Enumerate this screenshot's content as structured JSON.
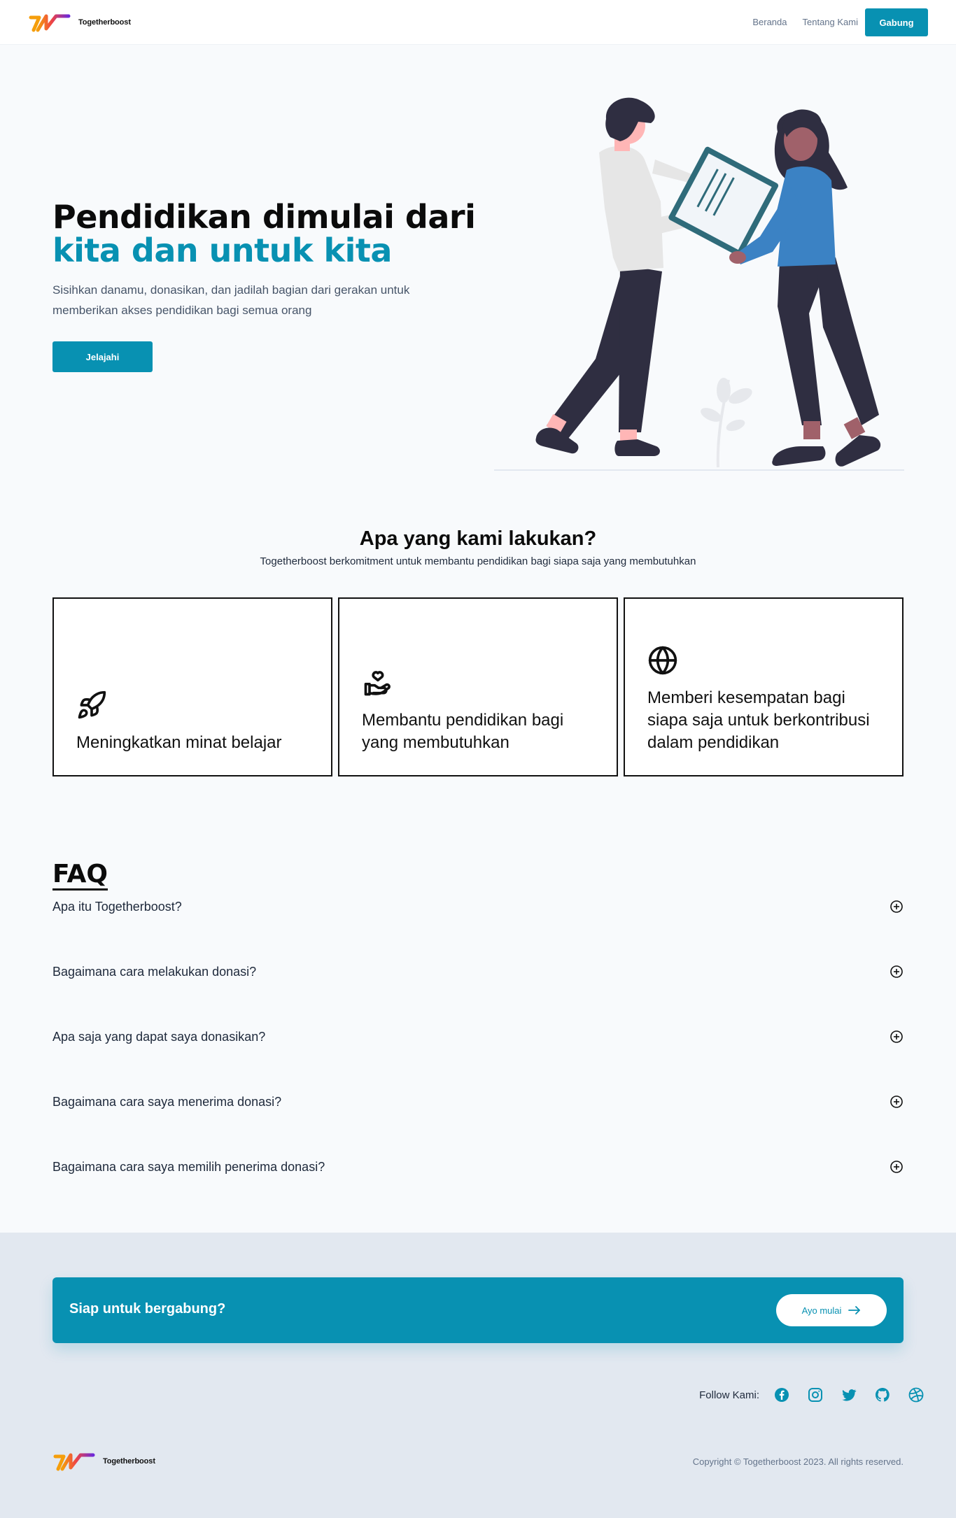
{
  "brand": {
    "name": "Togetherboost"
  },
  "nav": {
    "links": [
      "Beranda",
      "Tentang Kami"
    ],
    "cta": "Gabung"
  },
  "hero": {
    "title_line1": "Pendidikan dimulai dari",
    "title_line2": "kita dan untuk kita",
    "subtitle": "Sisihkan danamu, donasikan, dan jadilah bagian dari gerakan untuk memberikan akses pendidikan bagi semua orang",
    "button": "Jelajahi"
  },
  "what_we_do": {
    "title": "Apa yang kami lakukan?",
    "subtitle": "Togetherboost berkomitment untuk membantu pendidikan bagi siapa saja yang membutuhkan",
    "cards": [
      {
        "icon": "rocket-icon",
        "text": "Meningkatkan minat belajar"
      },
      {
        "icon": "hand-heart-icon",
        "text": "Membantu pendidikan bagi yang membutuhkan"
      },
      {
        "icon": "globe-icon",
        "text": "Memberi kesempatan bagi siapa saja untuk berkontribusi dalam pendidikan"
      }
    ]
  },
  "faq": {
    "title": "FAQ",
    "items": [
      "Apa itu Togetherboost?",
      "Bagaimana cara melakukan donasi?",
      "Apa saja yang dapat saya donasikan?",
      "Bagaimana cara saya menerima donasi?",
      "Bagaimana cara saya memilih penerima donasi?"
    ]
  },
  "cta": {
    "text": "Siap untuk bergabung?",
    "button": "Ayo mulai"
  },
  "footer": {
    "follow_label": "Follow Kami:",
    "socials": [
      "facebook-icon",
      "instagram-icon",
      "twitter-icon",
      "github-icon",
      "dribbble-icon"
    ],
    "copyright": "Copyright © Togetherboost 2023. All rights reserved."
  },
  "colors": {
    "accent": "#0891b2",
    "background": "#f8fafc",
    "footer_background": "#e2e8f0"
  }
}
